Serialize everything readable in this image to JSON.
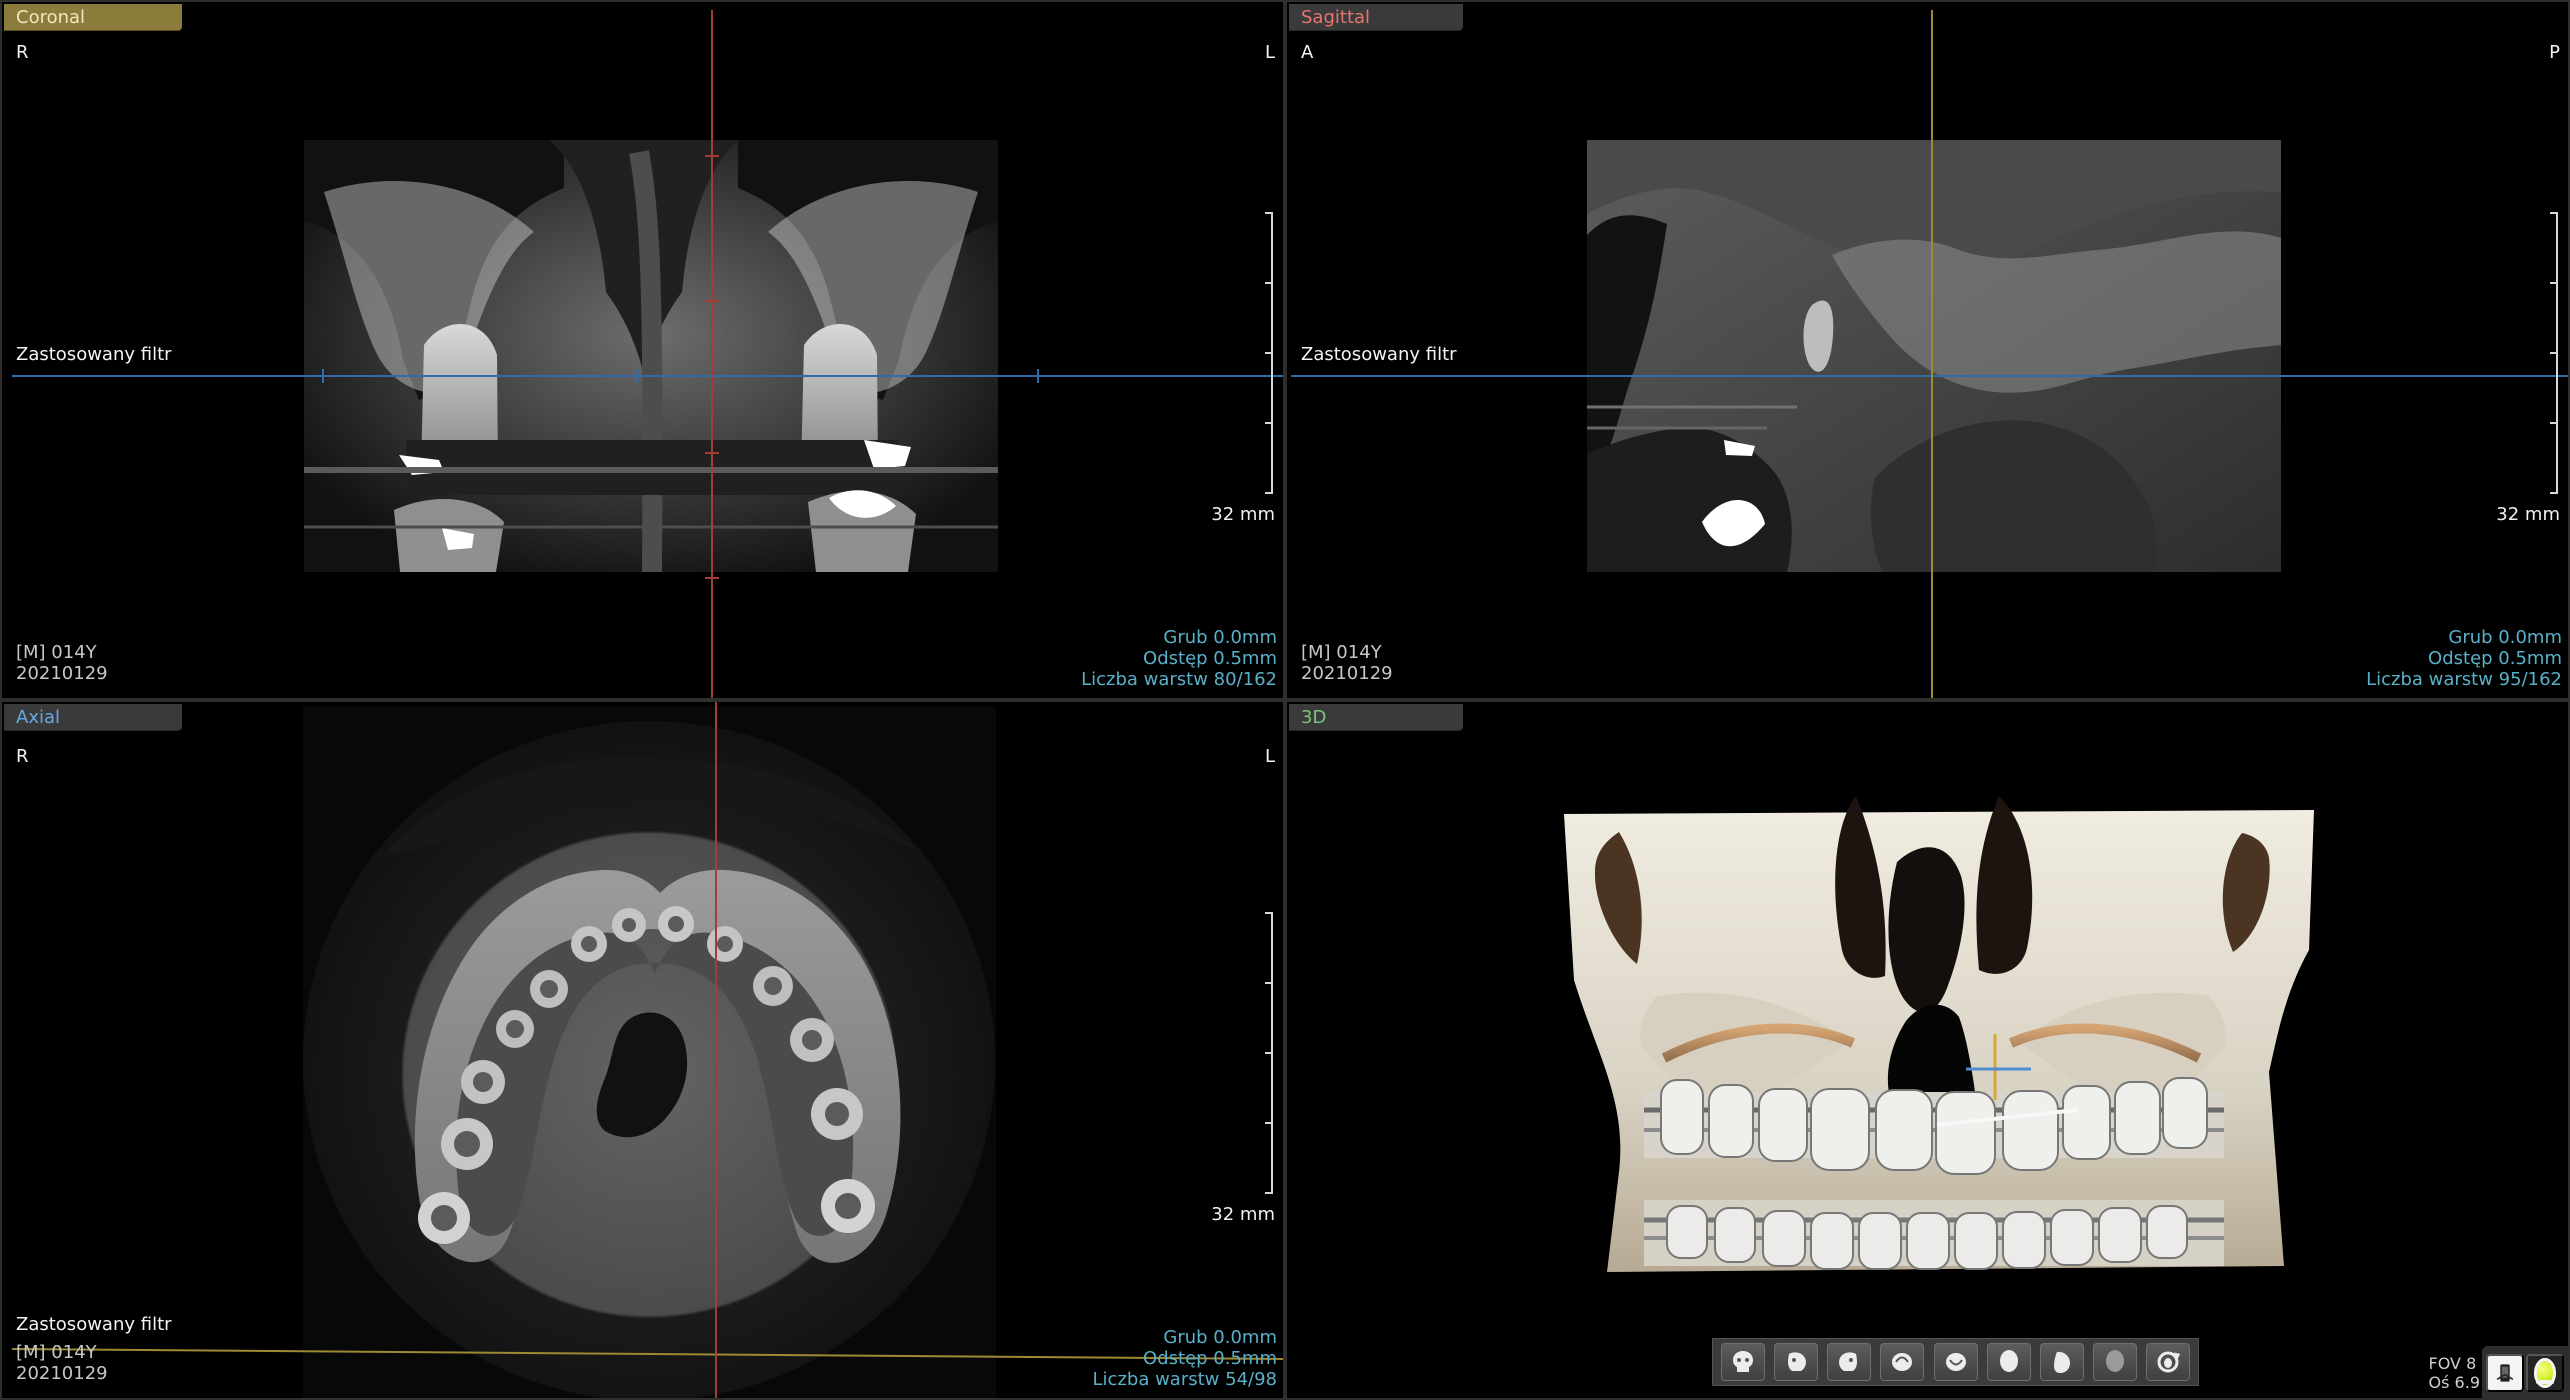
{
  "viewports": {
    "coronal": {
      "tab": "Coronal",
      "orientation_left": "R",
      "orientation_right": "L",
      "filter_label": "Zastosowany filtr",
      "scale": "32 mm",
      "patient_line": "[M] 014Y",
      "date_line": "20210129",
      "thickness": "Grub 0.0mm",
      "spacing": "Odstęp 0.5mm",
      "slices": "Liczba warstw 80/162"
    },
    "sagittal": {
      "tab": "Sagittal",
      "orientation_left": "A",
      "orientation_right": "P",
      "filter_label": "Zastosowany filtr",
      "scale": "32 mm",
      "patient_line": "[M] 014Y",
      "date_line": "20210129",
      "thickness": "Grub 0.0mm",
      "spacing": "Odstęp 0.5mm",
      "slices": "Liczba warstw 95/162"
    },
    "axial": {
      "tab": "Axial",
      "orientation_left": "R",
      "orientation_right": "L",
      "filter_label": "Zastosowany filtr",
      "scale": "32 mm",
      "patient_line": "[M] 014Y",
      "date_line": "20210129",
      "thickness": "Grub 0.0mm",
      "spacing": "Odstęp 0.5mm",
      "slices": "Liczba warstw 54/98"
    },
    "volume3d": {
      "tab": "3D",
      "fov_line": "FOV 8",
      "axis_line": "Oś 6.9"
    }
  },
  "toolbar3d": {
    "buttons": [
      {
        "icon": "skull-front-icon"
      },
      {
        "icon": "skull-left-icon"
      },
      {
        "icon": "skull-right-icon"
      },
      {
        "icon": "skull-top-icon"
      },
      {
        "icon": "skull-bottom-icon"
      },
      {
        "icon": "head-front-icon"
      },
      {
        "icon": "head-side-icon"
      },
      {
        "icon": "head-back-icon"
      },
      {
        "icon": "rotate-view-icon"
      }
    ]
  },
  "corner_tools": {
    "device_icon": "device-icon",
    "light_icon": "light-icon"
  },
  "colors": {
    "coronal_tab": "#8c7c3b",
    "sagittal_tab_text": "#e6766f",
    "axial_tab_text": "#68a7e7",
    "volume_tab_text": "#7cc37c",
    "info_text": "#5ab0c8",
    "blue_crosshair": "#2f6ea5",
    "red_crosshair": "#a33d37",
    "yellow_crosshair": "#9d8a35"
  }
}
